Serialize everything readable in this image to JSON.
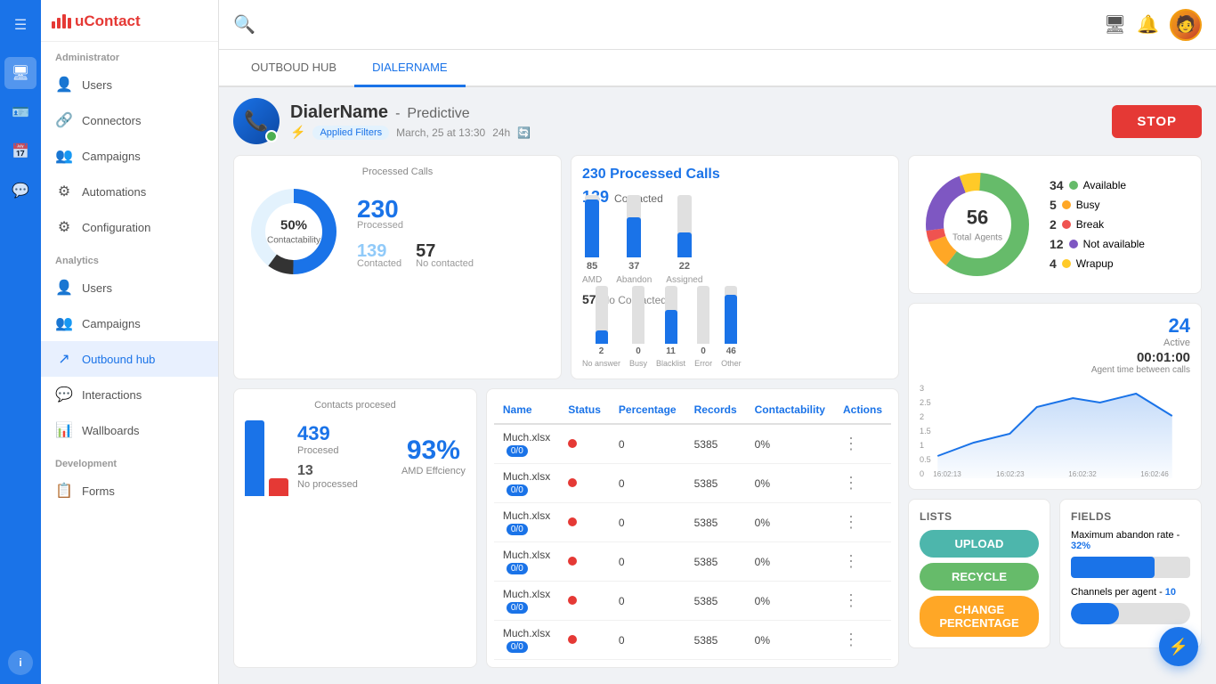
{
  "app": {
    "name": "uContact",
    "logo_bars": [
      8,
      12,
      16,
      12
    ]
  },
  "header": {
    "admin_label": "Administrator"
  },
  "tabs": [
    {
      "id": "outbound",
      "label": "OUTBOUD HUB"
    },
    {
      "id": "dialername",
      "label": "DIALERNAME"
    }
  ],
  "dialer": {
    "name": "DialerName",
    "separator": "-",
    "type": "Predictive",
    "filter_label": "Applied Filters",
    "date": "March, 25 at 13:30",
    "duration": "24h",
    "stop_label": "STOP"
  },
  "processed_calls": {
    "card_title": "Processed Calls",
    "donut_pct": "50%",
    "donut_label": "Contactability",
    "processed_num": "230",
    "processed_label": "Processed",
    "contacted_num": "139",
    "contacted_label": "Contacted",
    "no_contacted_num": "57",
    "no_contacted_label": "No contacted"
  },
  "bar_chart": {
    "title": "230 Processed Calls",
    "contacted": "139",
    "contacted_label": "Contacted",
    "bars": [
      {
        "label": "85",
        "name": "AMD",
        "height": 65,
        "blue": true
      },
      {
        "label": "37",
        "name": "Abandon",
        "height": 45,
        "blue": true
      },
      {
        "label": "22",
        "name": "Assigned",
        "height": 30,
        "blue": true
      }
    ],
    "no_contacted": "57",
    "no_contacted_label": "No Contacted",
    "nc_bars": [
      {
        "label": "2",
        "name": "No answer",
        "height": 20,
        "blue": true
      },
      {
        "label": "0",
        "name": "Busy",
        "height": 0,
        "blue": false
      },
      {
        "label": "11",
        "name": "Blacklist",
        "height": 40,
        "blue": true
      },
      {
        "label": "0",
        "name": "Error",
        "height": 0,
        "blue": false
      },
      {
        "label": "46",
        "name": "Other",
        "height": 60,
        "blue": true
      }
    ]
  },
  "contacts_card": {
    "title": "Contacts procesed",
    "processed_num": "439",
    "processed_label": "Procesed",
    "no_processed_num": "13",
    "no_processed_label": "No processed",
    "pct": "93%",
    "pct_label": "AMD Effciency"
  },
  "agents_donut": {
    "total": "56",
    "label1": "Total",
    "label2": "Agents",
    "segments": [
      {
        "label": "Available",
        "count": "34",
        "color": "#66bb6a"
      },
      {
        "label": "Busy",
        "count": "5",
        "color": "#ffa726"
      },
      {
        "label": "Break",
        "count": "2",
        "color": "#ef5350"
      },
      {
        "label": "Not available",
        "count": "12",
        "color": "#7e57c2"
      },
      {
        "label": "Wrapup",
        "count": "4",
        "color": "#26c6da"
      }
    ]
  },
  "line_chart": {
    "active_num": "24",
    "active_label": "Active",
    "time": "00:01:00",
    "time_label": "Agent time between calls",
    "x_labels": [
      "16:02:13",
      "16:02:23",
      "16:02:32",
      "16:02:46"
    ],
    "y_labels": [
      "3",
      "2.5",
      "2",
      "1.5",
      "1",
      "0.5",
      "0"
    ]
  },
  "table": {
    "columns": [
      "Name",
      "Status",
      "Percentage",
      "Records",
      "Contactability",
      "Actions"
    ],
    "rows": [
      {
        "name": "Much.xlsx",
        "tag": "0/0",
        "status": "red",
        "pct": "0",
        "records": "5385",
        "contactability": "0%"
      },
      {
        "name": "Much.xlsx",
        "tag": "0/0",
        "status": "red",
        "pct": "0",
        "records": "5385",
        "contactability": "0%"
      },
      {
        "name": "Much.xlsx",
        "tag": "0/0",
        "status": "red",
        "pct": "0",
        "records": "5385",
        "contactability": "0%"
      },
      {
        "name": "Much.xlsx",
        "tag": "0/0",
        "status": "red",
        "pct": "0",
        "records": "5385",
        "contactability": "0%"
      },
      {
        "name": "Much.xlsx",
        "tag": "0/0",
        "status": "red",
        "pct": "0",
        "records": "5385",
        "contactability": "0%"
      },
      {
        "name": "Much.xlsx",
        "tag": "0/0",
        "status": "red",
        "pct": "0",
        "records": "5385",
        "contactability": "0%"
      }
    ]
  },
  "lists": {
    "title": "LISTS",
    "upload_label": "UPLOAD",
    "recycle_label": "RECYCLE",
    "change_label": "CHANGE PERCENTAGE"
  },
  "fields": {
    "title": "FIELDS",
    "max_abandon": "Maximum abandon rate - ",
    "max_abandon_val": "32%",
    "channels_per": "Channels per agent - ",
    "channels_per_val": "10"
  },
  "nav": {
    "admin_section": "Administrator",
    "admin_items": [
      {
        "id": "users",
        "label": "Users",
        "icon": "👤"
      },
      {
        "id": "connectors",
        "label": "Connectors",
        "icon": "🔗"
      },
      {
        "id": "campaigns",
        "label": "Campaigns",
        "icon": "👥"
      },
      {
        "id": "automations",
        "label": "Automations",
        "icon": "⚙"
      },
      {
        "id": "configuration",
        "label": "Configuration",
        "icon": "⚙"
      }
    ],
    "analytics_section": "Analytics",
    "analytics_items": [
      {
        "id": "a-users",
        "label": "Users",
        "icon": "👤"
      },
      {
        "id": "a-campaigns",
        "label": "Campaigns",
        "icon": "👥"
      },
      {
        "id": "outbound-hub",
        "label": "Outbound hub",
        "icon": "↗"
      }
    ],
    "other_items": [
      {
        "id": "interactions",
        "label": "Interactions",
        "icon": "💬"
      },
      {
        "id": "wallboards",
        "label": "Wallboards",
        "icon": "📊"
      }
    ],
    "dev_section": "Development",
    "dev_items": [
      {
        "id": "forms",
        "label": "Forms",
        "icon": "📋"
      }
    ]
  }
}
